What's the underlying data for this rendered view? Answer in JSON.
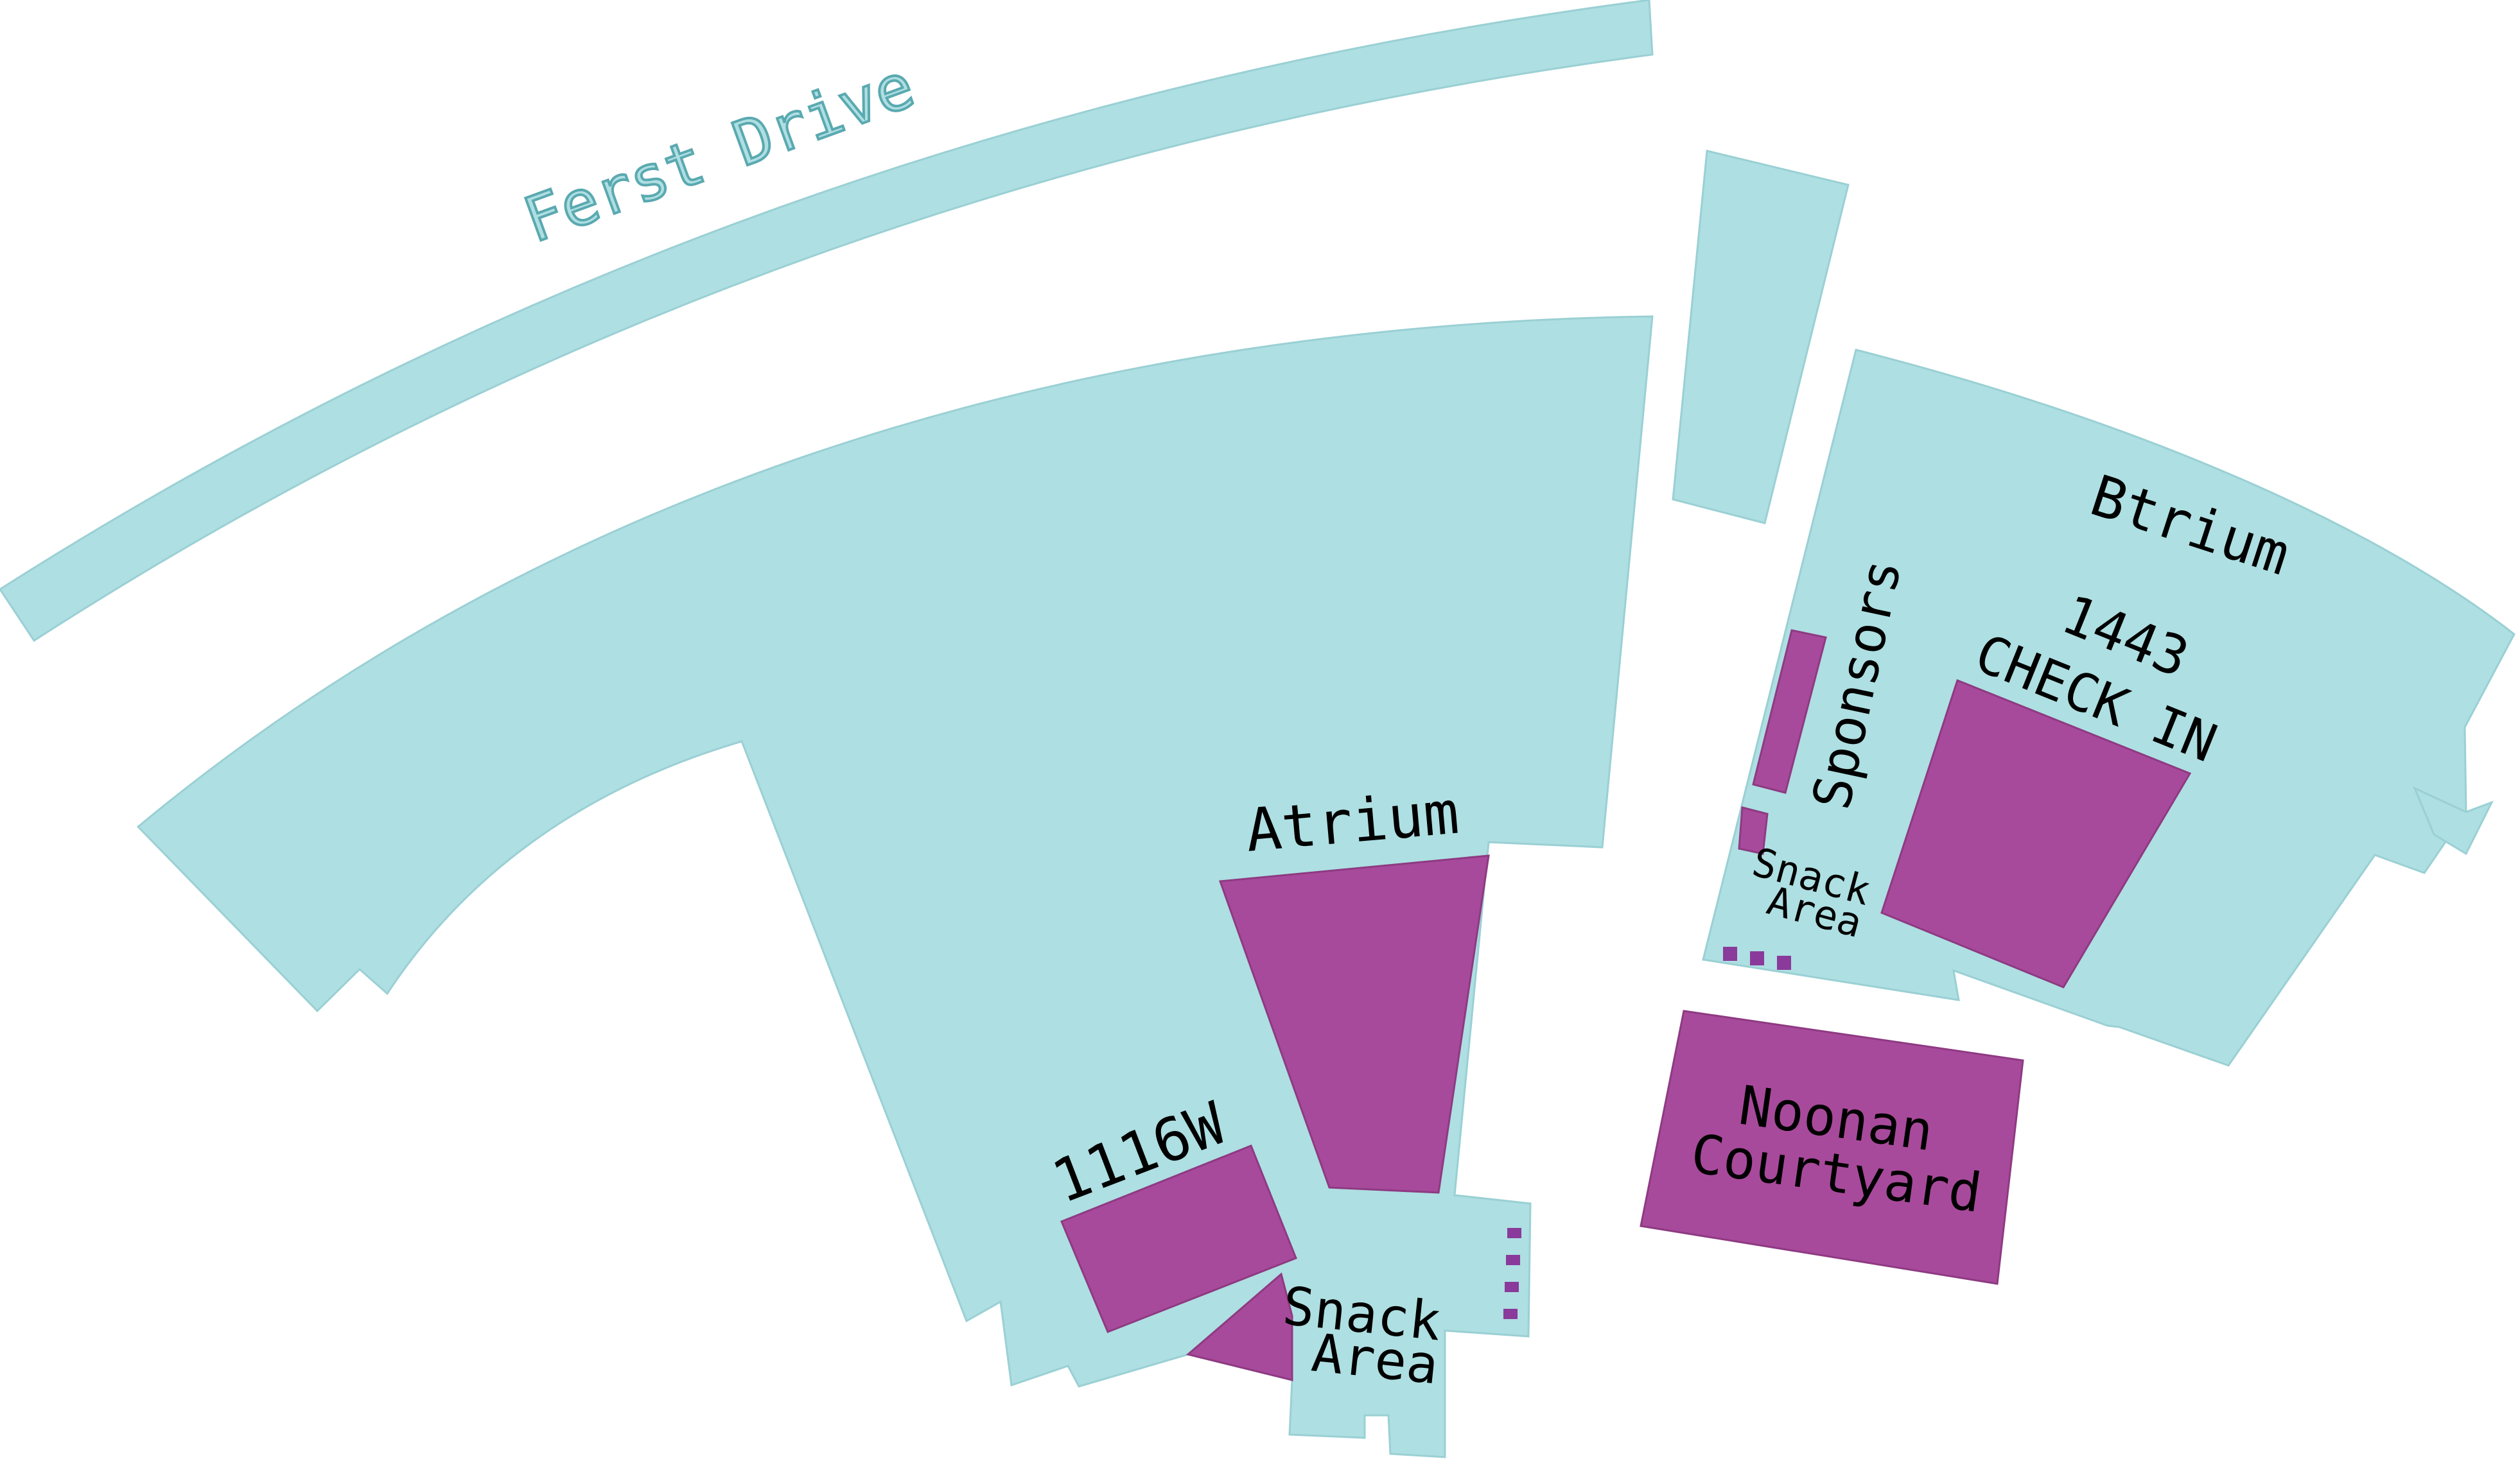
{
  "map": {
    "colors": {
      "floor": "#aedfe2",
      "floor_edge": "#9ad0d4",
      "room": "#a84a9b",
      "room_edge": "#8e3a82",
      "text": "#000000",
      "road_text": "#aedfe2",
      "road_text_outline": "#5aa9b0"
    },
    "road": {
      "name": "Ferst Drive"
    },
    "rooms": {
      "atrium": "Atrium",
      "btrium": "Btrium",
      "room_1116w": "1116W",
      "check_in_number": "1443",
      "check_in_label": "CHECK IN",
      "sponsors": "Sponsors",
      "snack_area_left_line1": "Snack",
      "snack_area_left_line2": "Area",
      "snack_area_right_line1": "Snack",
      "snack_area_right_line2": "Area",
      "noonan_line1": "Noonan",
      "noonan_line2": "Courtyard"
    }
  }
}
